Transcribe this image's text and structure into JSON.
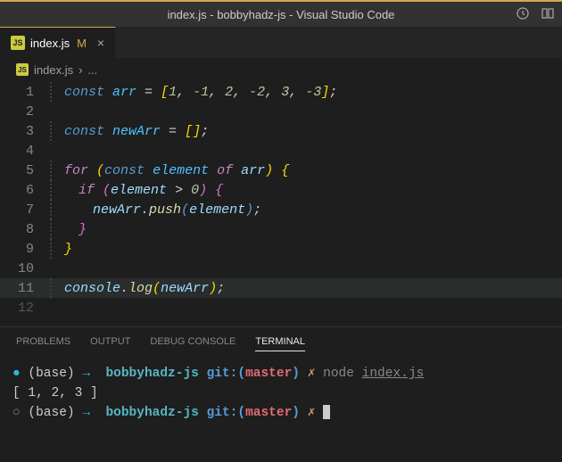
{
  "window": {
    "title": "index.js - bobbyhadz-js - Visual Studio Code"
  },
  "tab": {
    "iconText": "JS",
    "name": "index.js",
    "modified": "M",
    "close": "×"
  },
  "breadcrumb": {
    "iconText": "JS",
    "file": "index.js",
    "sep": "›",
    "more": "..."
  },
  "code": {
    "lines": [
      "1",
      "2",
      "3",
      "4",
      "5",
      "6",
      "7",
      "8",
      "9",
      "10",
      "11",
      "12"
    ],
    "l1": {
      "kw": "const",
      "v": "arr",
      "eq": " = ",
      "lb": "[",
      "n1": "1",
      "c1": ", ",
      "n2": "-1",
      "c2": ", ",
      "n3": "2",
      "c3": ", ",
      "n4": "-2",
      "c4": ", ",
      "n5": "3",
      "c5": ", ",
      "n6": "-3",
      "rb": "]",
      "sc": ";"
    },
    "l3": {
      "kw": "const",
      "v": "newArr",
      "eq": " = ",
      "lb": "[",
      "rb": "]",
      "sc": ";"
    },
    "l5": {
      "for": "for",
      "lp": "(",
      "kw": "const",
      "v": "element",
      "of": "of",
      "a": "arr",
      "rp": ")",
      "lb": "{"
    },
    "l6": {
      "if": "if",
      "lp": "(",
      "v": "element",
      "gt": " > ",
      "n": "0",
      "rp": ")",
      "lb": "{"
    },
    "l7": {
      "a": "newArr",
      "dot": ".",
      "fn": "push",
      "lp": "(",
      "v": "element",
      "rp": ")",
      "sc": ";"
    },
    "l8": {
      "rb": "}"
    },
    "l9": {
      "rb": "}"
    },
    "l11": {
      "c": "console",
      "dot": ".",
      "fn": "log",
      "lp": "(",
      "v": "newArr",
      "rp": ")",
      "sc": ";"
    }
  },
  "panel": {
    "problems": "PROBLEMS",
    "output": "OUTPUT",
    "debug": "DEBUG CONSOLE",
    "terminal": "TERMINAL"
  },
  "term": {
    "bullet_full": "●",
    "bullet_open": "○",
    "base": "(base)",
    "arrow": "→",
    "dir": "bobbyhadz-js",
    "git": "git:(",
    "branch": "master",
    "gitc": ")",
    "dirty": "✗",
    "cmd": "node",
    "file": "index.js",
    "output": "[ 1, 2, 3 ]"
  }
}
